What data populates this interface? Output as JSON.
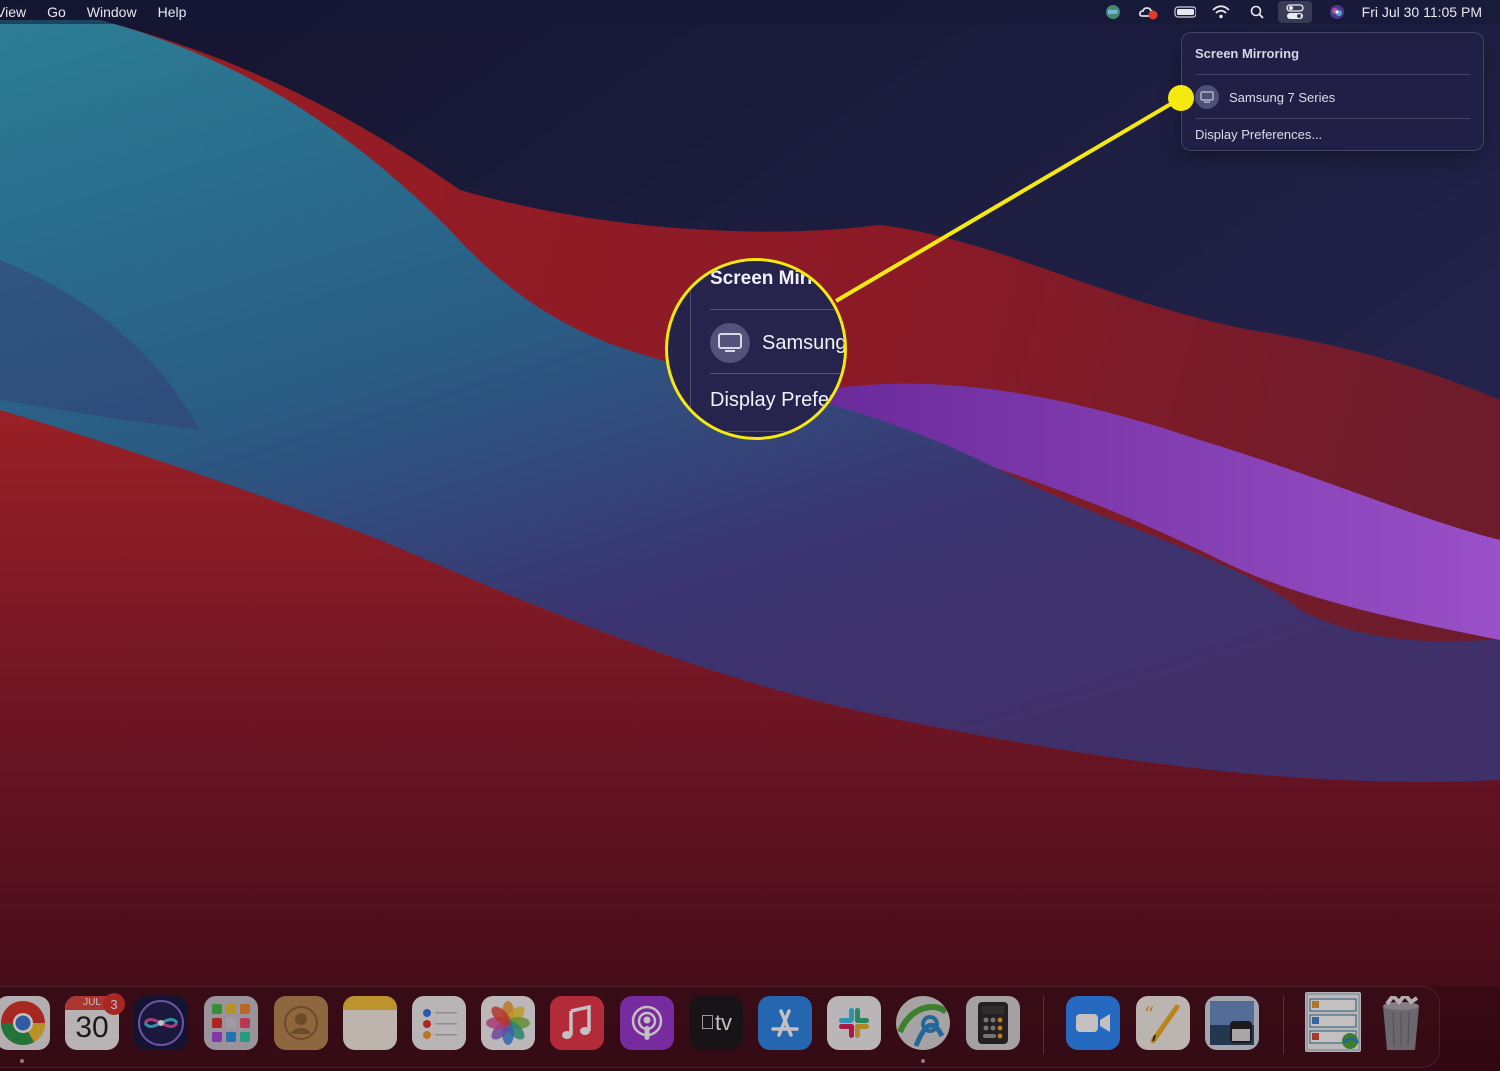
{
  "menubar": {
    "menus": [
      "View",
      "Go",
      "Window",
      "Help"
    ],
    "status_icons": [
      "globe-icon",
      "creative-cloud-icon",
      "battery-icon",
      "wifi-icon",
      "spotlight-search-icon",
      "control-center-icon",
      "siri-icon"
    ],
    "clock": "Fri Jul 30  11:05 PM"
  },
  "screen_mirroring_menu": {
    "title": "Screen Mirroring",
    "devices": [
      {
        "label": "Samsung 7 Series",
        "icon": "tv-icon"
      }
    ],
    "footer_item": "Display Preferences..."
  },
  "magnifier": {
    "title": "Screen Mirr",
    "device": "Samsung",
    "footer": "Display Prefer"
  },
  "colors": {
    "callout": "#f5e90f",
    "badge": "#d8342c",
    "menu_bg": "#222046"
  },
  "dock": {
    "items": [
      {
        "name": "Google Chrome",
        "icon": "chrome-icon",
        "running": true
      },
      {
        "name": "Calendar",
        "icon": "calendar-icon",
        "month": "JUL",
        "day": "30",
        "badge": "3"
      },
      {
        "name": "Siri",
        "icon": "siri-icon"
      },
      {
        "name": "Launchpad",
        "icon": "launchpad-icon"
      },
      {
        "name": "Contacts",
        "icon": "contacts-icon"
      },
      {
        "name": "Notes",
        "icon": "notes-icon"
      },
      {
        "name": "Reminders",
        "icon": "reminders-icon"
      },
      {
        "name": "Photos",
        "icon": "photos-icon"
      },
      {
        "name": "Music",
        "icon": "music-icon"
      },
      {
        "name": "Podcasts",
        "icon": "podcasts-icon"
      },
      {
        "name": "Apple TV",
        "icon": "apple-tv-icon",
        "label": "tv"
      },
      {
        "name": "App Store",
        "icon": "app-store-icon"
      },
      {
        "name": "Slack",
        "icon": "slack-icon"
      },
      {
        "name": "Network App",
        "icon": "network-globe-icon",
        "running": true
      },
      {
        "name": "Calculator",
        "icon": "calculator-icon"
      },
      {
        "name": "Zoom",
        "icon": "zoom-video-icon"
      },
      {
        "name": "Pages",
        "icon": "pages-icon"
      },
      {
        "name": "Preview",
        "icon": "preview-icon"
      },
      {
        "name": "Downloads Stack",
        "icon": "stack-icon"
      },
      {
        "name": "Trash",
        "icon": "trash-icon"
      }
    ]
  }
}
